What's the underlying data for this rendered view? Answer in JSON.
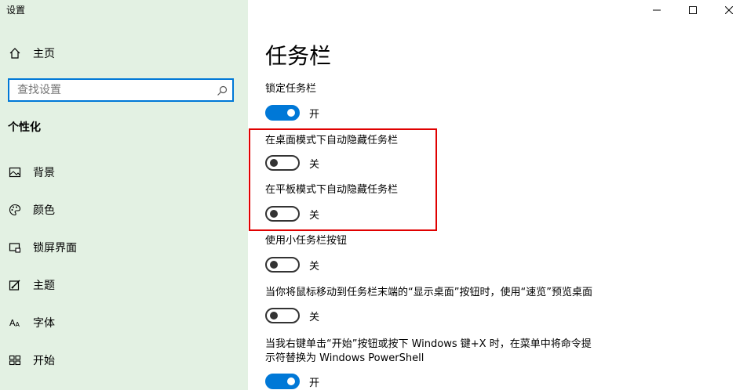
{
  "window": {
    "app_title": "设置",
    "minimize_icon": "minimize-icon",
    "maximize_icon": "maximize-icon",
    "close_icon": "close-icon"
  },
  "sidebar": {
    "home_label": "主页",
    "search": {
      "placeholder": "查找设置",
      "icon": "search-icon"
    },
    "section_title": "个性化",
    "items": [
      {
        "label": "背景",
        "icon": "image-icon"
      },
      {
        "label": "颜色",
        "icon": "palette-icon"
      },
      {
        "label": "锁屏界面",
        "icon": "lock-screen-icon"
      },
      {
        "label": "主题",
        "icon": "theme-icon"
      },
      {
        "label": "字体",
        "icon": "font-icon"
      },
      {
        "label": "开始",
        "icon": "start-icon"
      }
    ]
  },
  "main": {
    "page_title": "任务栏",
    "settings": [
      {
        "label": "锁定任务栏",
        "on": true,
        "state": "开"
      },
      {
        "label": "在桌面模式下自动隐藏任务栏",
        "on": false,
        "state": "关"
      },
      {
        "label": "在平板模式下自动隐藏任务栏",
        "on": false,
        "state": "关"
      },
      {
        "label": "使用小任务栏按钮",
        "on": false,
        "state": "关"
      },
      {
        "label": "当你将鼠标移动到任务栏末端的“显示桌面”按钮时，使用“速览”预览桌面",
        "on": false,
        "state": "关"
      },
      {
        "label_line1": "当我右键单击“开始”按钮或按下 Windows 键+X 时，在菜单中将命令提",
        "label_line2": "示符替换为 Windows PowerShell",
        "on": true,
        "state": "开"
      }
    ]
  },
  "colors": {
    "accent": "#0078d7",
    "sidebar_bg": "#e3f1e3",
    "highlight": "#e00000"
  }
}
